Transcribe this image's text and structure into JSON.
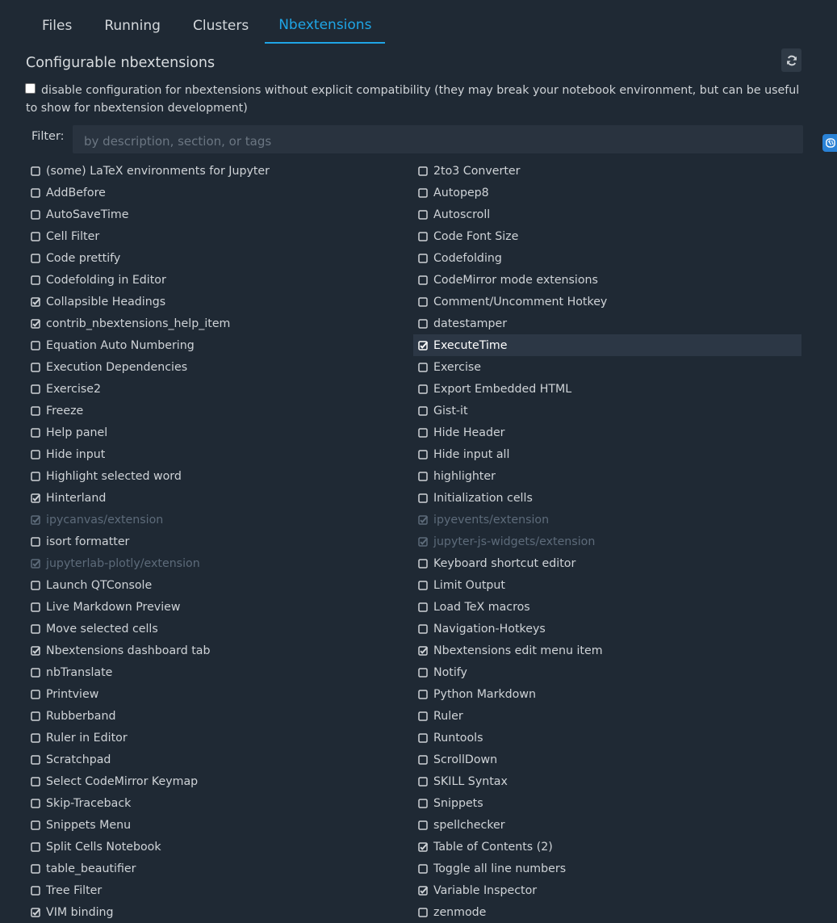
{
  "tabs": [
    {
      "label": "Files",
      "active": false
    },
    {
      "label": "Running",
      "active": false
    },
    {
      "label": "Clusters",
      "active": false
    },
    {
      "label": "Nbextensions",
      "active": true
    }
  ],
  "header": {
    "title": "Configurable nbextensions",
    "refresh_icon": "refresh-icon"
  },
  "compat": {
    "checked": false,
    "text": "disable configuration for nbextensions without explicit compatibility (they may break your notebook environment, but can be useful to show for nbextension development)"
  },
  "filter": {
    "label": "Filter:",
    "value": "",
    "placeholder": "by description, section, or tags"
  },
  "side_icon": "brain-icon",
  "colors": {
    "accent": "#1fa5e6",
    "background": "#1f2934",
    "text": "#cfd3d7",
    "disabled_text": "#5d6b7a",
    "selected_row": "#2c3745"
  },
  "extensions": [
    {
      "label": "(some) LaTeX environments for Jupyter",
      "checked": false,
      "disabled": false
    },
    {
      "label": "2to3 Converter",
      "checked": false,
      "disabled": false
    },
    {
      "label": "AddBefore",
      "checked": false,
      "disabled": false
    },
    {
      "label": "Autopep8",
      "checked": false,
      "disabled": false
    },
    {
      "label": "AutoSaveTime",
      "checked": false,
      "disabled": false
    },
    {
      "label": "Autoscroll",
      "checked": false,
      "disabled": false
    },
    {
      "label": "Cell Filter",
      "checked": false,
      "disabled": false
    },
    {
      "label": "Code Font Size",
      "checked": false,
      "disabled": false
    },
    {
      "label": "Code prettify",
      "checked": false,
      "disabled": false
    },
    {
      "label": "Codefolding",
      "checked": false,
      "disabled": false
    },
    {
      "label": "Codefolding in Editor",
      "checked": false,
      "disabled": false
    },
    {
      "label": "CodeMirror mode extensions",
      "checked": false,
      "disabled": false
    },
    {
      "label": "Collapsible Headings",
      "checked": true,
      "disabled": false
    },
    {
      "label": "Comment/Uncomment Hotkey",
      "checked": false,
      "disabled": false
    },
    {
      "label": "contrib_nbextensions_help_item",
      "checked": true,
      "disabled": false
    },
    {
      "label": "datestamper",
      "checked": false,
      "disabled": false
    },
    {
      "label": "Equation Auto Numbering",
      "checked": false,
      "disabled": false
    },
    {
      "label": "ExecuteTime",
      "checked": true,
      "disabled": false,
      "selected": true
    },
    {
      "label": "Execution Dependencies",
      "checked": false,
      "disabled": false
    },
    {
      "label": "Exercise",
      "checked": false,
      "disabled": false
    },
    {
      "label": "Exercise2",
      "checked": false,
      "disabled": false
    },
    {
      "label": "Export Embedded HTML",
      "checked": false,
      "disabled": false
    },
    {
      "label": "Freeze",
      "checked": false,
      "disabled": false
    },
    {
      "label": "Gist-it",
      "checked": false,
      "disabled": false
    },
    {
      "label": "Help panel",
      "checked": false,
      "disabled": false
    },
    {
      "label": "Hide Header",
      "checked": false,
      "disabled": false
    },
    {
      "label": "Hide input",
      "checked": false,
      "disabled": false
    },
    {
      "label": "Hide input all",
      "checked": false,
      "disabled": false
    },
    {
      "label": "Highlight selected word",
      "checked": false,
      "disabled": false
    },
    {
      "label": "highlighter",
      "checked": false,
      "disabled": false
    },
    {
      "label": "Hinterland",
      "checked": true,
      "disabled": false
    },
    {
      "label": "Initialization cells",
      "checked": false,
      "disabled": false
    },
    {
      "label": "ipycanvas/extension",
      "checked": true,
      "disabled": true
    },
    {
      "label": "ipyevents/extension",
      "checked": true,
      "disabled": true
    },
    {
      "label": "isort formatter",
      "checked": false,
      "disabled": false
    },
    {
      "label": "jupyter-js-widgets/extension",
      "checked": true,
      "disabled": true
    },
    {
      "label": "jupyterlab-plotly/extension",
      "checked": true,
      "disabled": true
    },
    {
      "label": "Keyboard shortcut editor",
      "checked": false,
      "disabled": false
    },
    {
      "label": "Launch QTConsole",
      "checked": false,
      "disabled": false
    },
    {
      "label": "Limit Output",
      "checked": false,
      "disabled": false
    },
    {
      "label": "Live Markdown Preview",
      "checked": false,
      "disabled": false
    },
    {
      "label": "Load TeX macros",
      "checked": false,
      "disabled": false
    },
    {
      "label": "Move selected cells",
      "checked": false,
      "disabled": false
    },
    {
      "label": "Navigation-Hotkeys",
      "checked": false,
      "disabled": false
    },
    {
      "label": "Nbextensions dashboard tab",
      "checked": true,
      "disabled": false
    },
    {
      "label": "Nbextensions edit menu item",
      "checked": true,
      "disabled": false
    },
    {
      "label": "nbTranslate",
      "checked": false,
      "disabled": false
    },
    {
      "label": "Notify",
      "checked": false,
      "disabled": false
    },
    {
      "label": "Printview",
      "checked": false,
      "disabled": false
    },
    {
      "label": "Python Markdown",
      "checked": false,
      "disabled": false
    },
    {
      "label": "Rubberband",
      "checked": false,
      "disabled": false
    },
    {
      "label": "Ruler",
      "checked": false,
      "disabled": false
    },
    {
      "label": "Ruler in Editor",
      "checked": false,
      "disabled": false
    },
    {
      "label": "Runtools",
      "checked": false,
      "disabled": false
    },
    {
      "label": "Scratchpad",
      "checked": false,
      "disabled": false
    },
    {
      "label": "ScrollDown",
      "checked": false,
      "disabled": false
    },
    {
      "label": "Select CodeMirror Keymap",
      "checked": false,
      "disabled": false
    },
    {
      "label": "SKILL Syntax",
      "checked": false,
      "disabled": false
    },
    {
      "label": "Skip-Traceback",
      "checked": false,
      "disabled": false
    },
    {
      "label": "Snippets",
      "checked": false,
      "disabled": false
    },
    {
      "label": "Snippets Menu",
      "checked": false,
      "disabled": false
    },
    {
      "label": "spellchecker",
      "checked": false,
      "disabled": false
    },
    {
      "label": "Split Cells Notebook",
      "checked": false,
      "disabled": false
    },
    {
      "label": "Table of Contents (2)",
      "checked": true,
      "disabled": false
    },
    {
      "label": "table_beautifier",
      "checked": false,
      "disabled": false
    },
    {
      "label": "Toggle all line numbers",
      "checked": false,
      "disabled": false
    },
    {
      "label": "Tree Filter",
      "checked": false,
      "disabled": false
    },
    {
      "label": "Variable Inspector",
      "checked": true,
      "disabled": false
    },
    {
      "label": "VIM binding",
      "checked": true,
      "disabled": false
    },
    {
      "label": "zenmode",
      "checked": false,
      "disabled": false
    }
  ]
}
